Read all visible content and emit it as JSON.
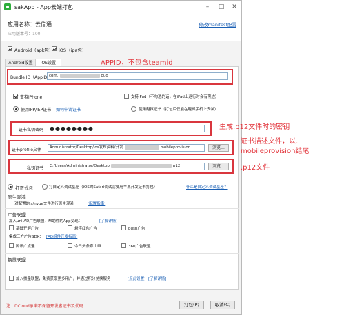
{
  "window": {
    "title": "sakApp - App云端打包"
  },
  "header": {
    "app_name": "应用名称：云信通",
    "app_version": "应用版本号：100",
    "manifest_link": "修改manifest配置"
  },
  "platforms": {
    "android_label": "Android（apk包）",
    "ios_label": "iOS（ipa包）"
  },
  "tabs": [
    {
      "label": "Android设置"
    },
    {
      "label": "iOS设置"
    }
  ],
  "ios": {
    "bundle_label": "Bundle ID（AppID）",
    "bundle_value": "com.",
    "bundle_suffix": "oud",
    "support_iphone": "支持iPhone",
    "support_ipad": "支持iPad（不勾选的话，在iPad上运行时会有黑边）",
    "own_cert": "使用IPP/IEP证书",
    "how_apply": "如何申请证书",
    "jailbreak_cert": "使用越狱证书（打包后仅能在越狱手机上安装）",
    "cert_pwd_label": "证书私钥密码",
    "cert_pwd_value": "●●●●●●●●",
    "profile_label": "证书profile文件",
    "profile_value": "Administrator/Desktop/ios发布资料/开发",
    "profile_suffix": "mobileprovision",
    "p12_label": "私钥证书",
    "p12_value": "C:/Users/Administrator/Desktop",
    "p12_suffix": "p12",
    "browse": "浏览..."
  },
  "pack": {
    "formal": "打正式包",
    "custom_base": "打自定义调试基座（iOS的Safari调试需要用苹果开发证书打包）",
    "custom_base_link": "什么是自定义调试基座？"
  },
  "native": {
    "title": "原生混淆",
    "item": "对配置的js/nvue文件进行原生混淆",
    "link": "[配置指南]"
  },
  "ads": {
    "title": "广告联盟",
    "intro": "加入uni-AD广告联盟，帮助你的App变现：",
    "intro_link": "[了解详情]",
    "basic": "基础开屏广告",
    "gdt": "悬浮红包广告",
    "push": "push广告",
    "sdk_line": "集成三方广告SDK：",
    "sdk_link": "[AD组件开发指南]",
    "tencent": "腾讯广点通",
    "toutiao": "今日头条穿山甲",
    "ad360": "360广告联盟"
  },
  "exchange": {
    "title": "换量联盟",
    "item": "加入换量联盟，免费获取更多用户，并通过积分兑换服务",
    "link1": "[点此设置]",
    "link2": "[了解详情]"
  },
  "footer": {
    "warning": "注：DCloud承诺不保留开发者证书及代码",
    "pack_btn": "打包(P)",
    "cancel_btn": "取消(C)"
  },
  "annotations": {
    "appid": "APPID，不包含teamid",
    "pwd": "生成.p12文件时的密钥",
    "profile_line1": "证书描述文件，以.",
    "profile_line2": "mobileprovision结尾",
    "p12": ".p12文件"
  },
  "colors": {
    "annotation": "#e2343b",
    "link": "#1a5fb4",
    "warning": "#d53b3b"
  }
}
